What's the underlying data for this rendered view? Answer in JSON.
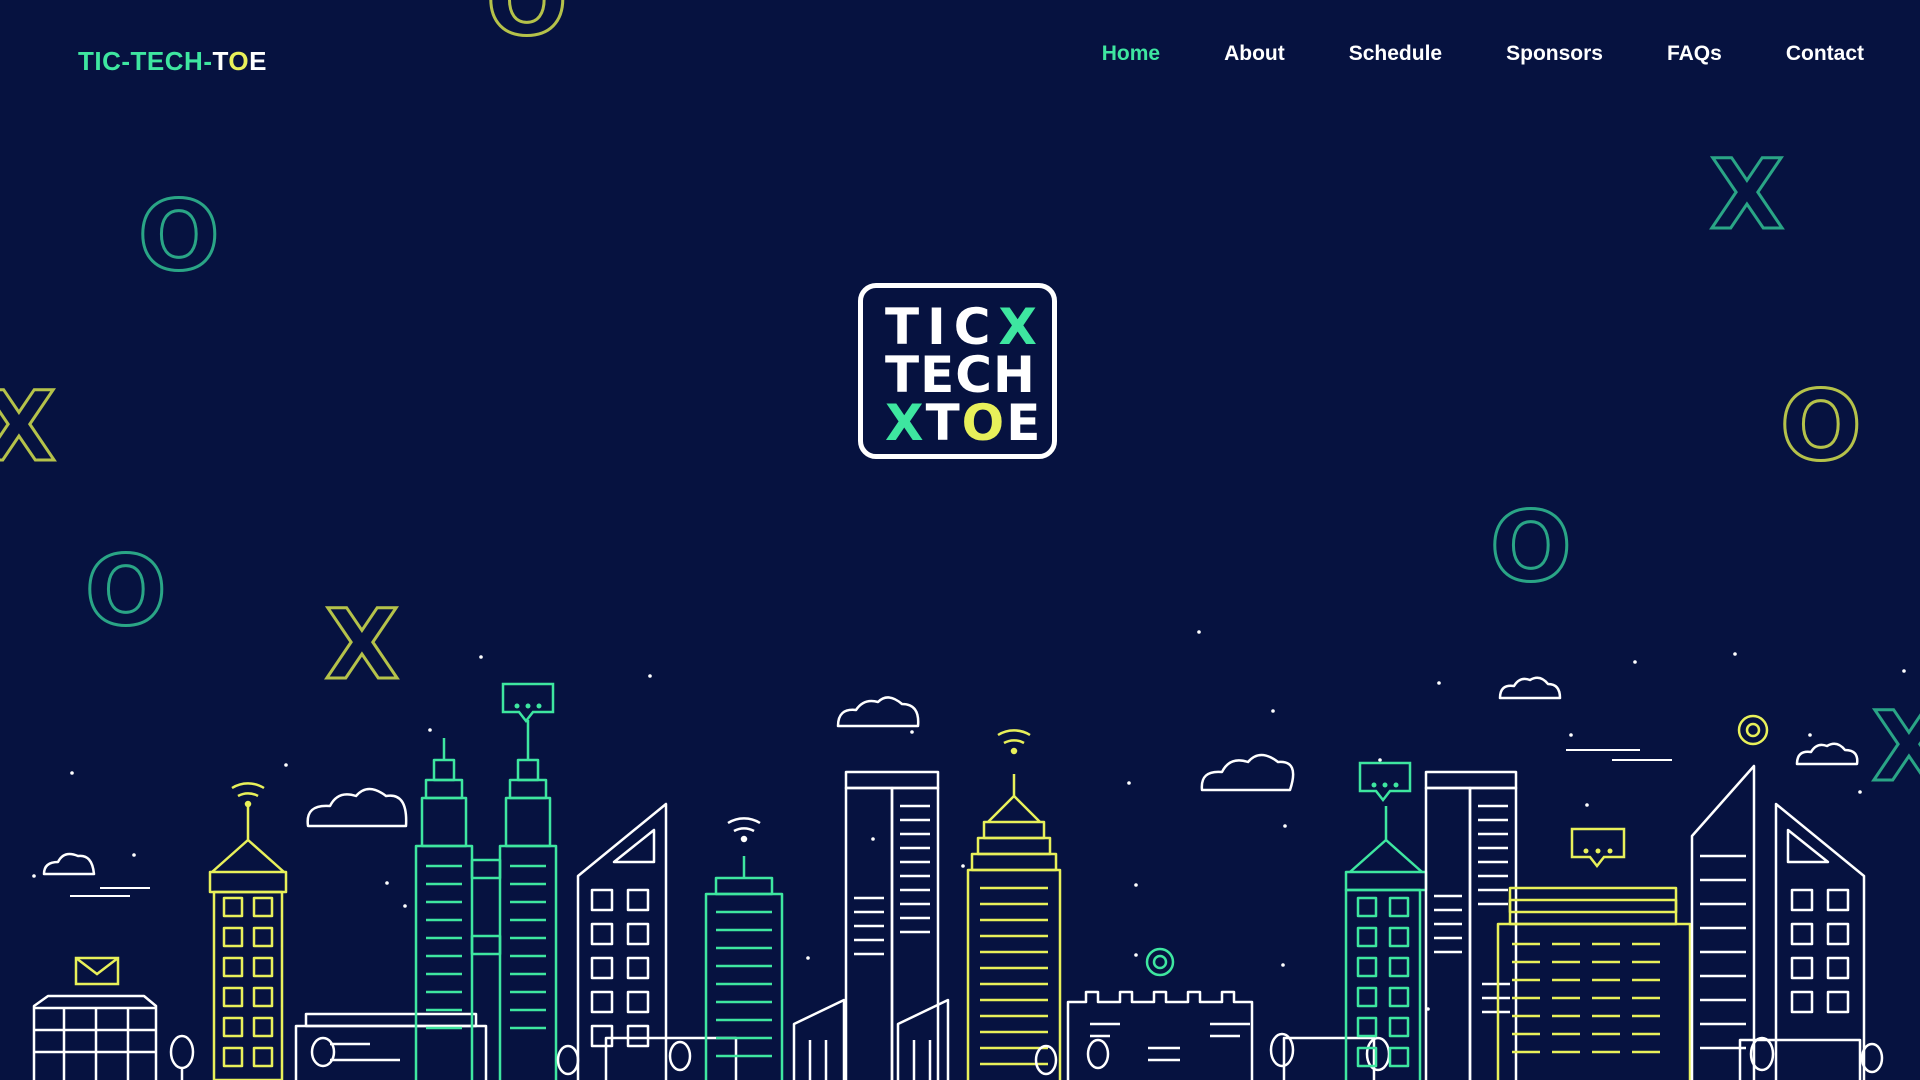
{
  "brand": {
    "part1": "TIC-TECH-",
    "part2": "T",
    "part3": "O",
    "part4": "E"
  },
  "nav": {
    "items": [
      "Home",
      "About",
      "Schedule",
      "Sponsors",
      "FAQs",
      "Contact"
    ],
    "active": "Home"
  },
  "logo": {
    "row1a": "TIC",
    "row1b": "X",
    "row2": "TECH",
    "row3a": "X",
    "row3b": "T",
    "row3c": "O",
    "row3d": "E"
  },
  "colors": {
    "background": "#061240",
    "green": "#3ee6a0",
    "teal": "#2aa586",
    "yellow": "#e8f05a",
    "olive": "#b5c24a",
    "white": "#ffffff"
  }
}
